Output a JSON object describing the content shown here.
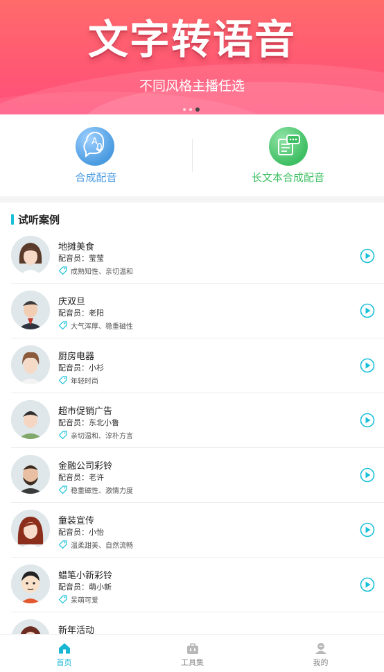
{
  "banner": {
    "title": "文字转语音",
    "subtitle": "不同风格主播任选",
    "slides": 3,
    "active_slide": 3
  },
  "actions": [
    {
      "label": "合成配音",
      "icon": "voice-synthesis-icon",
      "color": "#4a9be0"
    },
    {
      "label": "长文本合成配音",
      "icon": "long-text-icon",
      "color": "#3fbf63"
    }
  ],
  "section": {
    "title": "试听案例"
  },
  "samples": [
    {
      "title": "地摊美食",
      "voice": "配音员：莹莹",
      "tags": "成熟知性、亲切温和"
    },
    {
      "title": "庆双旦",
      "voice": "配音员：老阳",
      "tags": "大气浑厚、稳重磁性"
    },
    {
      "title": "厨房电器",
      "voice": "配音员：小杉",
      "tags": "年轻时尚"
    },
    {
      "title": "超市促销广告",
      "voice": "配音员：东北小鲁",
      "tags": "亲切温和、淳朴方言"
    },
    {
      "title": "金融公司彩铃",
      "voice": "配音员：老许",
      "tags": "稳重磁性、激情力度"
    },
    {
      "title": "童装宣传",
      "voice": "配音员：小怡",
      "tags": "温柔甜美、自然流畅"
    },
    {
      "title": "蜡笔小新彩铃",
      "voice": "配音员：萌小新",
      "tags": "呆萌可爱"
    },
    {
      "title": "新年活动",
      "voice": "",
      "tags": ""
    }
  ],
  "tabs": [
    {
      "label": "首页",
      "icon": "home-icon",
      "active": true
    },
    {
      "label": "工具集",
      "icon": "toolbox-icon",
      "active": false
    },
    {
      "label": "我的",
      "icon": "profile-icon",
      "active": false
    }
  ],
  "colors": {
    "accent": "#19c0d9",
    "banner": "#ff5a73",
    "action_blue": "#4a9be0",
    "action_green": "#3fbf63"
  }
}
